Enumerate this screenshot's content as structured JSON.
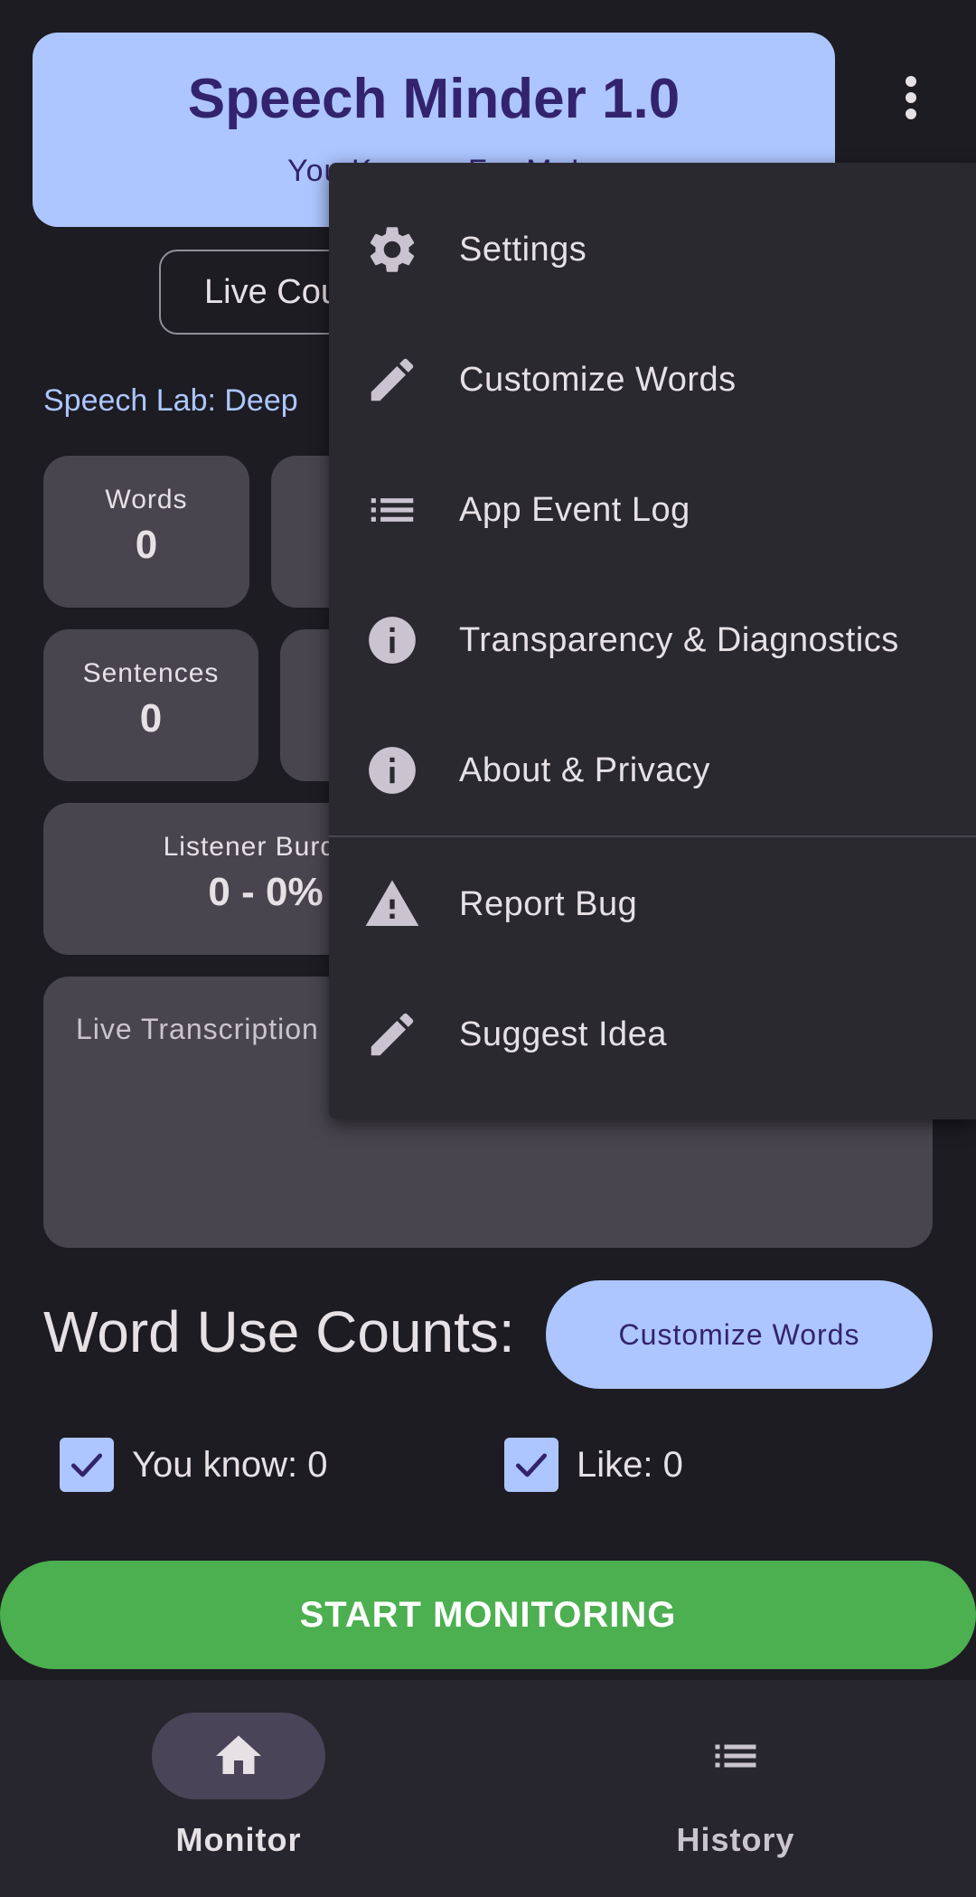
{
  "header": {
    "title": "Speech Minder 1.0",
    "subtitle": "You Know... For Me!"
  },
  "mode_chip": {
    "label": "Live Counting"
  },
  "engine_line": "Speech Lab: Deep",
  "stats": {
    "words": {
      "label": "Words",
      "value": "0"
    },
    "sentences": {
      "label": "Sentences",
      "value": "0"
    },
    "burden": {
      "label": "Listener Burden",
      "value": "0 - 0%"
    }
  },
  "transcript": {
    "label": "Live Transcription"
  },
  "counts": {
    "heading": "Word Use Counts:",
    "customize_label": "Customize Words",
    "items": [
      {
        "label": "You know: 0",
        "checked": true
      },
      {
        "label": "Like: 0",
        "checked": true
      }
    ]
  },
  "start_button": "START MONITORING",
  "nav": {
    "items": [
      {
        "label": "Monitor",
        "icon": "home-icon",
        "active": true
      },
      {
        "label": "History",
        "icon": "list-icon",
        "active": false
      }
    ]
  },
  "menu": {
    "items": [
      {
        "label": "Settings",
        "icon": "gear-icon"
      },
      {
        "label": "Customize Words",
        "icon": "pencil-icon"
      },
      {
        "label": "App Event Log",
        "icon": "list-icon"
      },
      {
        "label": "Transparency & Diagnostics",
        "icon": "info-icon"
      },
      {
        "label": "About & Privacy",
        "icon": "info-icon"
      },
      {
        "label": "Report Bug",
        "icon": "warning-icon"
      },
      {
        "label": "Suggest Idea",
        "icon": "pencil-icon"
      }
    ]
  },
  "colors": {
    "background": "#1d1c22",
    "primary_container": "#adc6ff",
    "on_primary_container": "#33236e",
    "tile": "#49454f",
    "start_green": "#4caf50",
    "menu_surface": "#2a2930"
  }
}
